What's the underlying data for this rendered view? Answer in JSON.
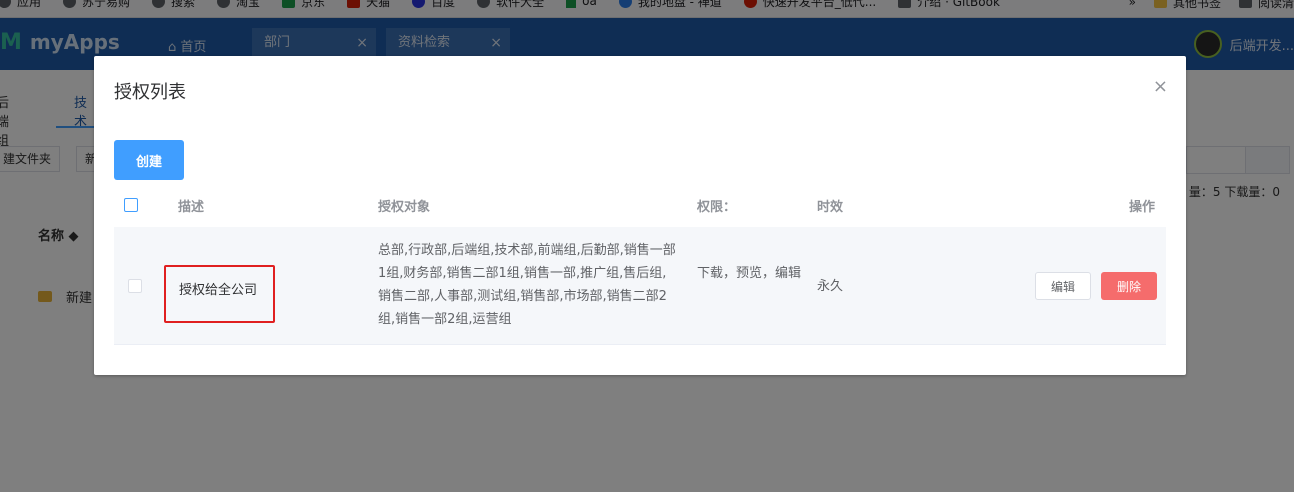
{
  "bookmarks": {
    "items": [
      {
        "label": "应用",
        "color": "#5f6368"
      },
      {
        "label": "苏宁易购",
        "color": "#5f6368"
      },
      {
        "label": "搜索",
        "color": "#5f6368"
      },
      {
        "label": "淘宝",
        "color": "#5f6368"
      },
      {
        "label": "京东",
        "color": "#1a9e4a"
      },
      {
        "label": "天猫",
        "color": "#d81e06"
      },
      {
        "label": "百度",
        "color": "#2932e1"
      },
      {
        "label": "软件大全",
        "color": "#5f6368"
      },
      {
        "label": "oa",
        "color": "#1a9e4a"
      },
      {
        "label": "我的地盘 - 禅道",
        "color": "#2b7de9"
      },
      {
        "label": "快速开发平台_低代...",
        "color": "#d81e06"
      },
      {
        "label": "介绍 · GitBook",
        "color": "#5f6368"
      }
    ],
    "more": "»",
    "other": "其他书签",
    "reading": "阅读清"
  },
  "app": {
    "logo": "myApps",
    "home": "首页",
    "tabs": [
      {
        "label": "部门",
        "close": "×"
      },
      {
        "label": "资料检索",
        "close": "×"
      }
    ],
    "user": "后端开发..."
  },
  "background": {
    "tab_a": "后端组",
    "tab_b": "技术",
    "btn_new_folder": "建文件夹",
    "btn_other": "新",
    "stats": "量：5  下载量：0",
    "name_col": "名称 ◆",
    "row_name": "新建"
  },
  "dialog": {
    "title": "授权列表",
    "close": "×",
    "create": "创建",
    "columns": {
      "desc": "描述",
      "target": "授权对象",
      "perm": "权限：",
      "expiry": "时效",
      "ops": "操作"
    },
    "rows": [
      {
        "desc": "授权给全公司",
        "target": "总部,行政部,后端组,技术部,前端组,后勤部,销售一部1组,财务部,销售二部1组,销售一部,推广组,售后组,销售二部,人事部,测试组,销售部,市场部,销售二部2组,销售一部2组,运营组",
        "perm": "下载，预览，编辑",
        "expiry": "永久",
        "edit": "编辑",
        "delete": "删除"
      }
    ]
  },
  "colors": {
    "primary": "#409eff",
    "danger": "#f56c6c",
    "highlight": "#e02020",
    "header": "#1e5aa8"
  }
}
